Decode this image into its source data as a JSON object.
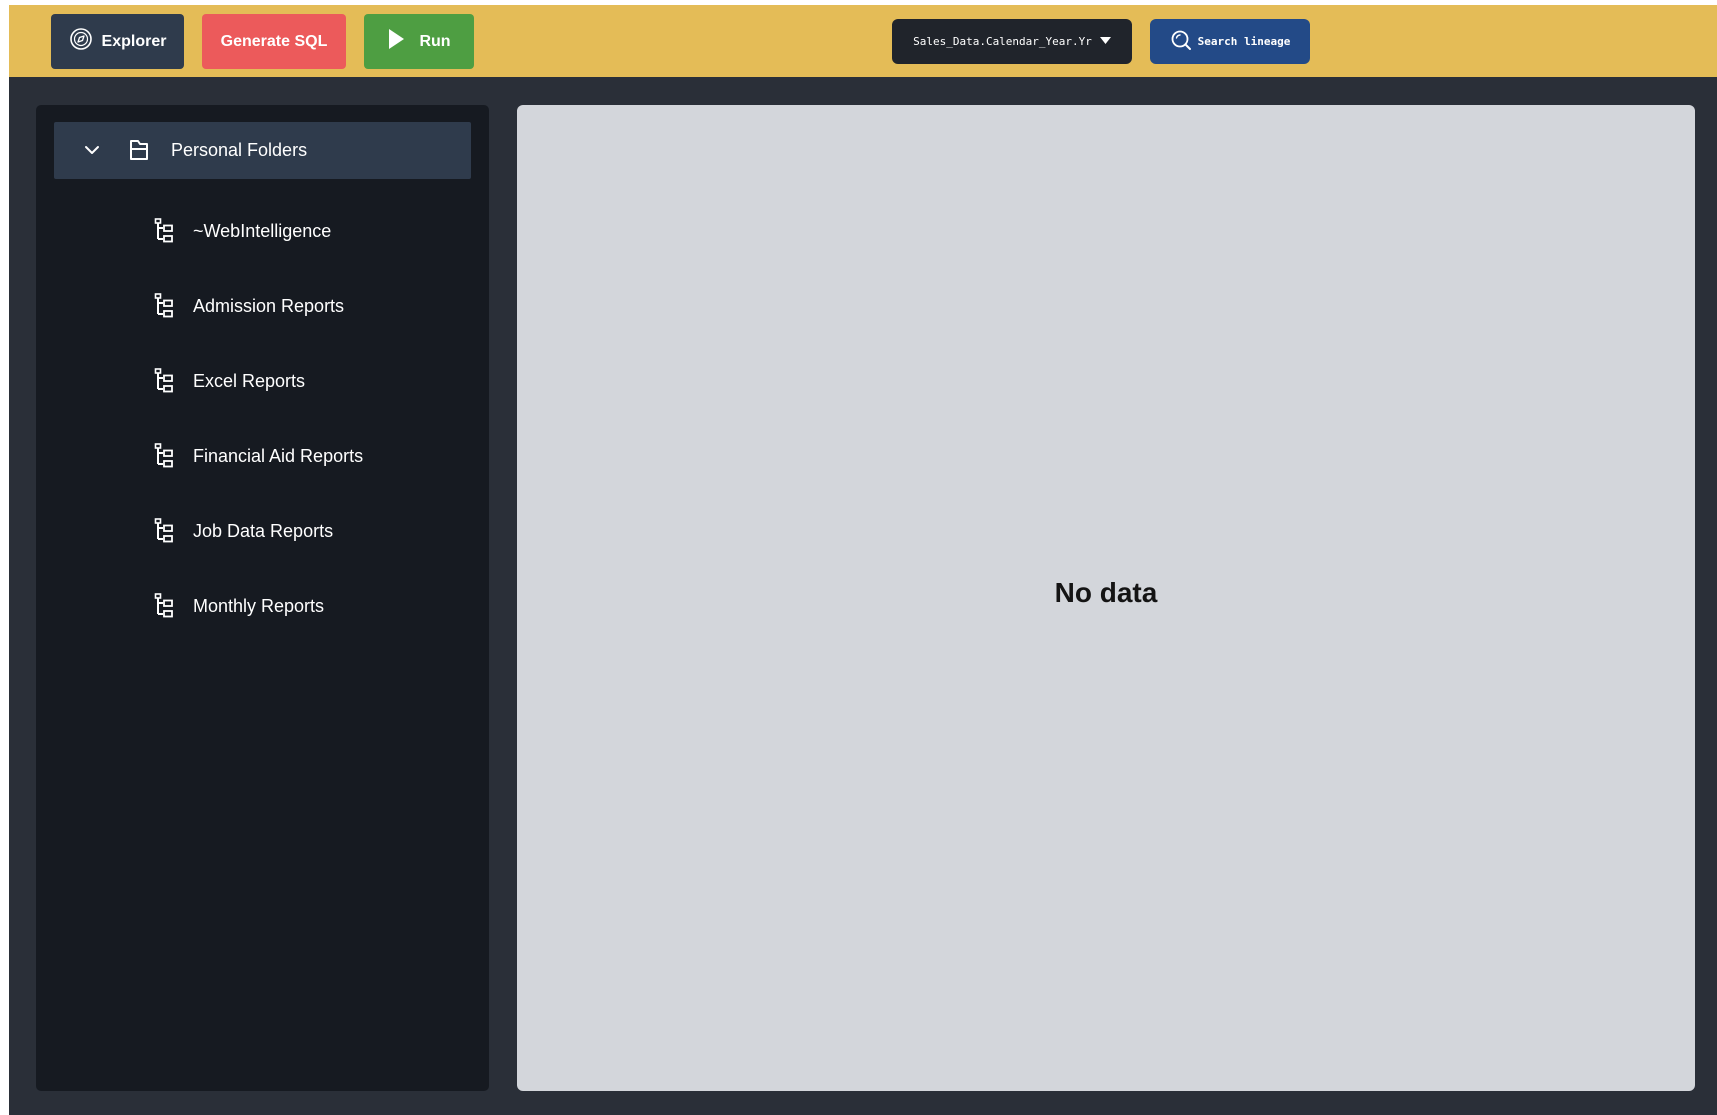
{
  "toolbar": {
    "explorer_label": "Explorer",
    "generate_sql_label": "Generate SQL",
    "run_label": "Run",
    "field_select_value": "Sales_Data.Calendar_Year.Yr",
    "search_lineage_label": "Search lineage"
  },
  "sidebar": {
    "folder": {
      "label": "Personal Folders",
      "expanded": true,
      "icon": "folder-icon"
    },
    "items": [
      {
        "label": "~WebIntelligence",
        "icon": "tree-icon"
      },
      {
        "label": "Admission Reports",
        "icon": "tree-icon"
      },
      {
        "label": "Excel Reports",
        "icon": "tree-icon"
      },
      {
        "label": "Financial Aid Reports",
        "icon": "tree-icon"
      },
      {
        "label": "Job Data Reports",
        "icon": "tree-icon"
      },
      {
        "label": "Monthly Reports",
        "icon": "tree-icon"
      }
    ]
  },
  "main": {
    "empty_message": "No data"
  },
  "colors": {
    "toolbar_bg": "#e4bc57",
    "explorer_bg": "#2f3b4c",
    "generate_bg": "#ec5a5b",
    "run_bg": "#4e9e42",
    "search_bg": "#234a87",
    "sidebar_bg": "#161a21",
    "content_bg": "#d3d6db"
  }
}
